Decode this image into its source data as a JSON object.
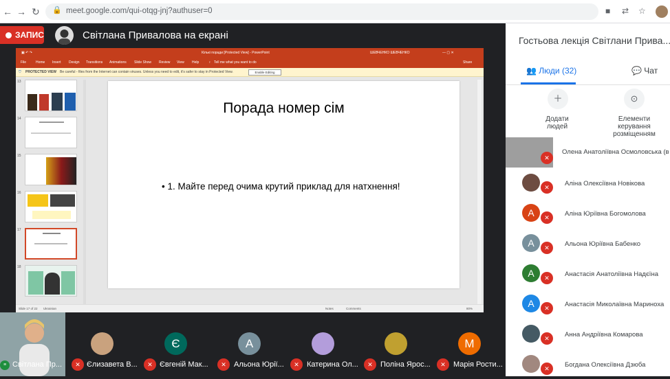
{
  "browser": {
    "url": "meet.google.com/qui-otqg-jnj?authuser=0",
    "back_icon": "arrow-left",
    "forward_icon": "arrow-right",
    "reload_icon": "reload"
  },
  "meet": {
    "record_label": "ЗАПИС",
    "presenter_title": "Світлана Привалова на екрані"
  },
  "ppt": {
    "window_title": "Кількі поради [Protected View] - PowerPoint",
    "user_label": "ШЕВЧЕНКО ШЕВЧЕНКО",
    "ribbon_tabs": [
      "File",
      "Home",
      "Insert",
      "Design",
      "Transitions",
      "Animations",
      "Slide Show",
      "Review",
      "View",
      "Help"
    ],
    "tell_me": "Tell me what you want to do",
    "share": "Share",
    "protected_label": "PROTECTED VIEW",
    "protected_text": "Be careful - files from the Internet can contain viruses. Unless you need to edit, it's safer to stay in Protected View.",
    "enable_editing": "Enable Editing",
    "thumb_numbers": [
      "13",
      "14",
      "15",
      "16",
      "17",
      "18"
    ],
    "slide_title": "Порада номер сім",
    "slide_bullet": "• 1. Майте перед очима крутий приклад для натхнення!",
    "status_slide": "Slide 17 of 22",
    "status_lang": "Ukrainian",
    "status_notes": "Notes",
    "status_comments": "Comments",
    "status_zoom": "80%"
  },
  "panel": {
    "title": "Гостьова лекція Світлани Прива...",
    "tab_people": "Люди (32)",
    "tab_chat": "Чат",
    "add_people": "Додати людей",
    "controls": "Елементи керування розміщенням",
    "participants": [
      {
        "name": "Олена Анатоліївна Осмоловська (в",
        "initial": "",
        "color": "#8d6e63"
      },
      {
        "name": "Аліна Олексіївна Новікова",
        "initial": "",
        "color": "#6d4c41"
      },
      {
        "name": "Аліна Юріївна Богомолова",
        "initial": "А",
        "color": "#d84315"
      },
      {
        "name": "Альона Юріївна Бабенко",
        "initial": "А",
        "color": "#78909c"
      },
      {
        "name": "Анастасія Анатоліївна Надєїна",
        "initial": "А",
        "color": "#2e7d32"
      },
      {
        "name": "Анастасія Миколаївна Мариноха",
        "initial": "А",
        "color": "#1e88e5"
      },
      {
        "name": "Анна Андріївна Комарова",
        "initial": "",
        "color": "#455a64"
      },
      {
        "name": "Богдана Олексіївна Дзюба",
        "initial": "",
        "color": "#a1887f"
      }
    ]
  },
  "strip": {
    "self_label": "Світлана Пр...",
    "tiles": [
      {
        "label": "Єлизавета В...",
        "initial": "",
        "color": "#c9a27e"
      },
      {
        "label": "Євгеній Мак...",
        "initial": "Є",
        "color": "#00695c"
      },
      {
        "label": "Альона Юрії...",
        "initial": "А",
        "color": "#78909c"
      },
      {
        "label": "Катерина Ол...",
        "initial": "",
        "color": "#b39ddb"
      },
      {
        "label": "Поліна Ярос...",
        "initial": "",
        "color": "#c0a030"
      },
      {
        "label": "Марія Рости...",
        "initial": "М",
        "color": "#ef6c00"
      }
    ]
  }
}
